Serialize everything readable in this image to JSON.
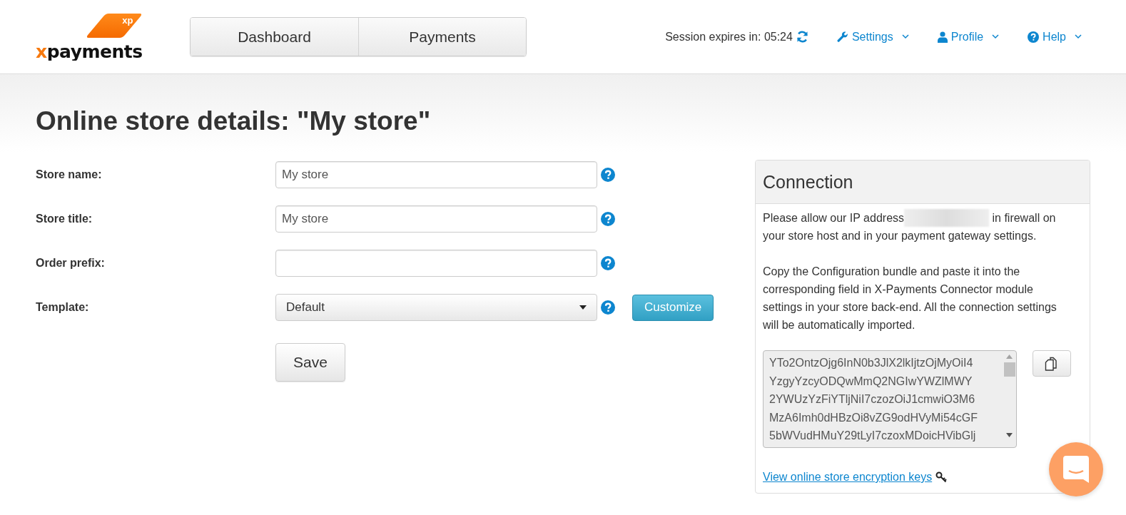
{
  "header": {
    "logo": {
      "prefix": "x",
      "name": "payments",
      "badge": "xp"
    },
    "nav": [
      {
        "label": "Dashboard"
      },
      {
        "label": "Payments"
      }
    ],
    "session": {
      "label": "Session expires in: 05:24"
    },
    "menus": [
      {
        "kind": "settings",
        "label": "Settings"
      },
      {
        "kind": "profile",
        "label": "Profile"
      },
      {
        "kind": "help",
        "label": "Help"
      }
    ]
  },
  "page": {
    "title": "Online store details: \"My store\""
  },
  "form": {
    "rows": [
      {
        "kind": "text",
        "label": "Store name:",
        "value": "My store"
      },
      {
        "kind": "text",
        "label": "Store title:",
        "value": "My store"
      },
      {
        "kind": "text",
        "label": "Order prefix:"
      },
      {
        "kind": "select",
        "label": "Template:",
        "value": "Default",
        "action": "Customize"
      }
    ],
    "save": "Save"
  },
  "connection": {
    "title": "Connection",
    "ip_note": {
      "before": "Please allow our IP address",
      "after": "in firewall on your store host and in your payment gateway settings."
    },
    "instructions": "Copy the Configuration bundle and paste it into the corresponding field in X-Payments Connector module settings in your store back-end. All the connection settings will be automatically imported.",
    "bundle_lines": [
      "YTo2OntzOjg6InN0b3JlX2lkIjtzOjMyOiI4",
      "YzgyYzcyODQwMmQ2NGIwYWZlMWY",
      "2YWUzYzFiYTljNiI7czozOiJ1cmwiO3M6",
      "MzA6Imh0dHBzOi8vZG9odHVyMi54cGF",
      "5bWVudHMuY29tLyI7czoxMDoicHVibGlj"
    ],
    "link": "View online store encryption keys"
  }
}
